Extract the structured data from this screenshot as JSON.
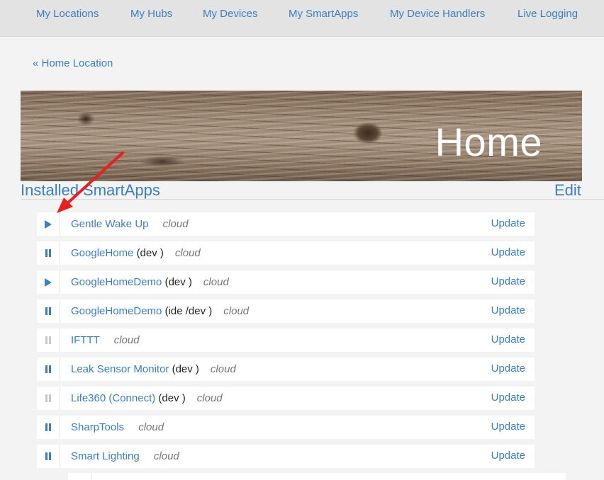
{
  "nav": {
    "items": [
      "My Locations",
      "My Hubs",
      "My Devices",
      "My SmartApps",
      "My Device Handlers",
      "Live Logging"
    ]
  },
  "breadcrumb": {
    "label": "« Home Location"
  },
  "banner": {
    "title": "Home"
  },
  "section": {
    "title": "Installed SmartApps",
    "edit_label": "Edit"
  },
  "apps": [
    {
      "name": "Gentle Wake Up",
      "suffix": "",
      "env": "cloud",
      "status": "play",
      "action": "Update"
    },
    {
      "name": "GoogleHome",
      "suffix": "(dev  )",
      "env": "cloud",
      "status": "pause",
      "action": "Update"
    },
    {
      "name": "GoogleHomeDemo",
      "suffix": "(dev  )",
      "env": "cloud",
      "status": "play",
      "action": "Update"
    },
    {
      "name": "GoogleHomeDemo",
      "suffix": "(ide  /dev  )",
      "env": "cloud",
      "status": "pause",
      "action": "Update"
    },
    {
      "name": "IFTTT",
      "suffix": "",
      "env": "cloud",
      "status": "pause-off",
      "action": "Update"
    },
    {
      "name": "Leak Sensor Monitor",
      "suffix": "(dev  )",
      "env": "cloud",
      "status": "pause",
      "action": "Update"
    },
    {
      "name": "Life360 (Connect)",
      "suffix": "(dev  )",
      "env": "cloud",
      "status": "pause-off",
      "action": "Update"
    },
    {
      "name": "SharpTools",
      "suffix": "",
      "env": "cloud",
      "status": "pause",
      "action": "Update"
    },
    {
      "name": "Smart Lighting",
      "suffix": "",
      "env": "cloud",
      "status": "pause",
      "action": "Update"
    }
  ],
  "colors": {
    "link": "#3a7fc1",
    "annotation_arrow": "#e8201f"
  }
}
